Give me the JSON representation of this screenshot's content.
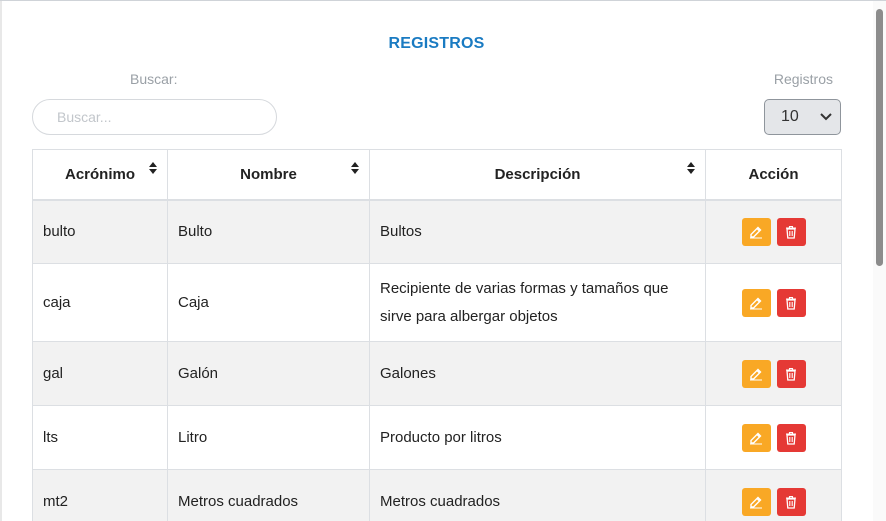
{
  "title": "REGISTROS",
  "search": {
    "label": "Buscar:",
    "placeholder": "Buscar...",
    "value": ""
  },
  "page_size": {
    "label": "Registros",
    "value": "10"
  },
  "table": {
    "columns": [
      "Acrónimo",
      "Nombre",
      "Descripción",
      "Acción"
    ],
    "rows": [
      {
        "acronimo": "bulto",
        "nombre": "Bulto",
        "descripcion": "Bultos"
      },
      {
        "acronimo": "caja",
        "nombre": "Caja",
        "descripcion": "Recipiente de varias formas y tamaños que sirve para albergar objetos"
      },
      {
        "acronimo": "gal",
        "nombre": "Galón",
        "descripcion": "Galones"
      },
      {
        "acronimo": "lts",
        "nombre": "Litro",
        "descripcion": "Producto por litros"
      },
      {
        "acronimo": "mt2",
        "nombre": "Metros cuadrados",
        "descripcion": "Metros cuadrados"
      }
    ]
  },
  "icons": {
    "edit": "edit-icon",
    "delete": "trash-icon",
    "sort": "sort-icon",
    "dropdown": "chevron-down-icon"
  },
  "colors": {
    "title": "#1a7bc2",
    "edit_button": "#f9a825",
    "delete_button": "#e53935"
  }
}
